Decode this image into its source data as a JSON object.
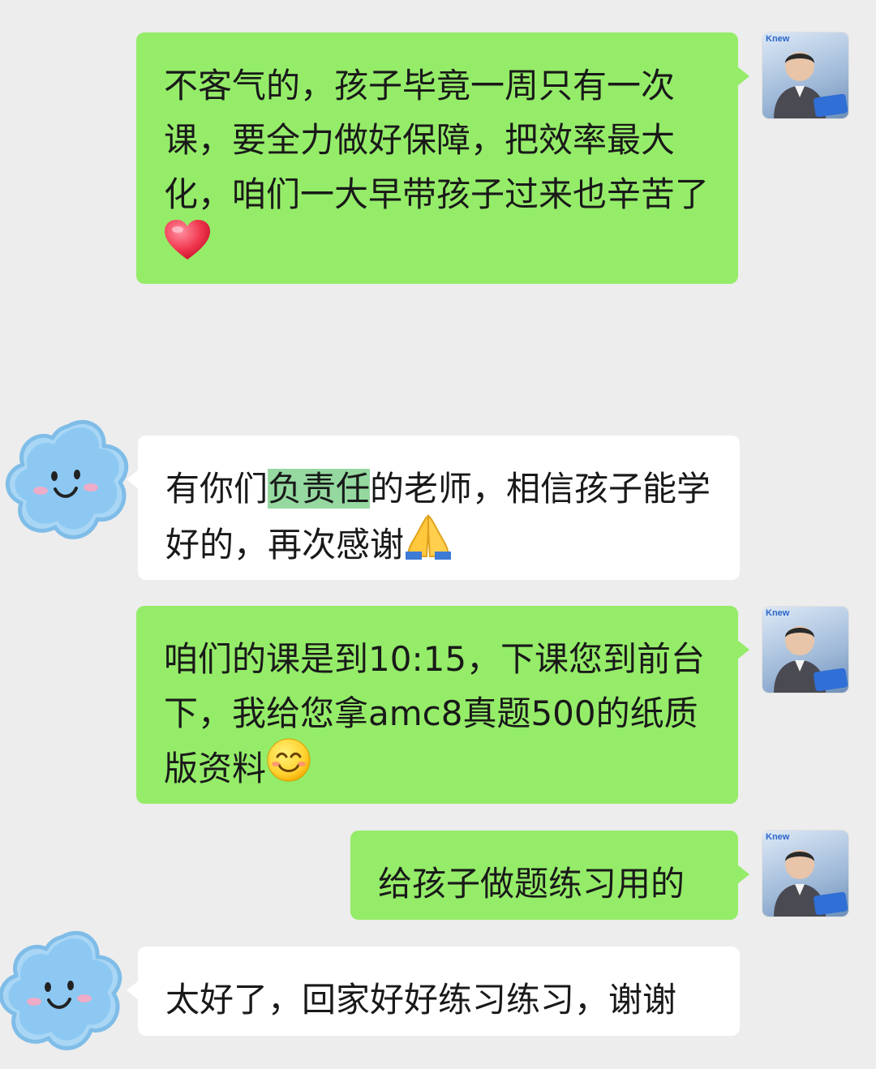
{
  "messages": [
    {
      "id": "m1",
      "direction": "out",
      "text": "不客气的，孩子毕竟一周只有一次课，要全力做好保障，把效率最大化，咱们一大早带孩子过来也辛苦了",
      "emoji": "heart-emoji"
    },
    {
      "id": "m2",
      "direction": "in",
      "text_before": "有你们",
      "highlight": "负责任",
      "text_after": "的老师，相信孩子能学好的，再次感谢",
      "emoji": "folded-hands-emoji"
    },
    {
      "id": "m3",
      "direction": "out",
      "text": "咱们的课是到10:15，下课您到前台下，我给您拿amc8真题500的纸质版资料",
      "emoji": "smiling-face-emoji"
    },
    {
      "id": "m4",
      "direction": "out",
      "text": "给孩子做题练习用的"
    },
    {
      "id": "m5",
      "direction": "in",
      "text": "太好了，回家好好练习练习，谢谢"
    }
  ],
  "avatars": {
    "teacher_logo": "Knew",
    "teacher_icon": "teacher-avatar",
    "parent_icon": "cloud-avatar"
  },
  "colors": {
    "background": "#ededed",
    "outgoing_bubble": "#95ec69",
    "incoming_bubble": "#ffffff",
    "highlight": "#95d9a0",
    "text": "#191919"
  }
}
